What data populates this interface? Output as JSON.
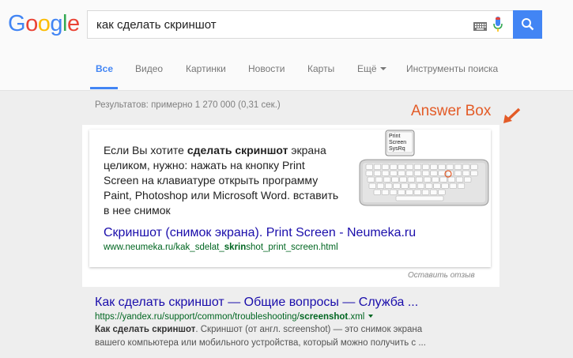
{
  "logo": {
    "letters": [
      "G",
      "o",
      "o",
      "g",
      "l",
      "e"
    ],
    "colors": [
      "#4285f4",
      "#ea4335",
      "#fbbc05",
      "#4285f4",
      "#34a853",
      "#ea4335"
    ]
  },
  "search": {
    "query": "как сделать скриншот"
  },
  "tabs": [
    {
      "label": "Все",
      "active": true
    },
    {
      "label": "Видео"
    },
    {
      "label": "Картинки"
    },
    {
      "label": "Новости"
    },
    {
      "label": "Карты"
    },
    {
      "label": "Ещё"
    },
    {
      "label": "Инструменты поиска"
    }
  ],
  "stats": "Результатов: примерно 1 270 000 (0,31 сек.)",
  "annotation": "Answer Box",
  "answer_box": {
    "snippet_pre": "Если Вы хотите ",
    "snippet_bold": "сделать скриншот",
    "snippet_post": " экрана целиком, нужно: нажать на кнопку Print Screen на клавиатуре открыть программу Paint, Photoshop или Microsoft Word. вставить в нее снимок",
    "key_label": [
      "Print",
      "Screen",
      "SysRq"
    ],
    "title": "Скриншот (снимок экрана). Print Screen - Neumeka.ru",
    "url_pre": "www.neumeka.ru/kak_sdelat_",
    "url_bold": "skrin",
    "url_post": "shot_print_screen.html",
    "feedback": "Оставить отзыв"
  },
  "result2": {
    "title": "Как сделать скриншот — Общие вопросы — Служба ...",
    "url_pre": "https://yandex.ru/support/common/troubleshooting/",
    "url_bold": "screenshot",
    "url_post": ".xml",
    "snippet_bold": "Как сделать скриншот",
    "snippet_line1": ". Скриншот (от англ. screenshot) — это снимок экрана",
    "snippet_line2": "вашего компьютера или мобильного устройства, который можно получить с ..."
  },
  "colors": {
    "accent": "#4285f4",
    "link": "#1a0dab",
    "url_green": "#006621",
    "annotation": "#e35b27"
  }
}
